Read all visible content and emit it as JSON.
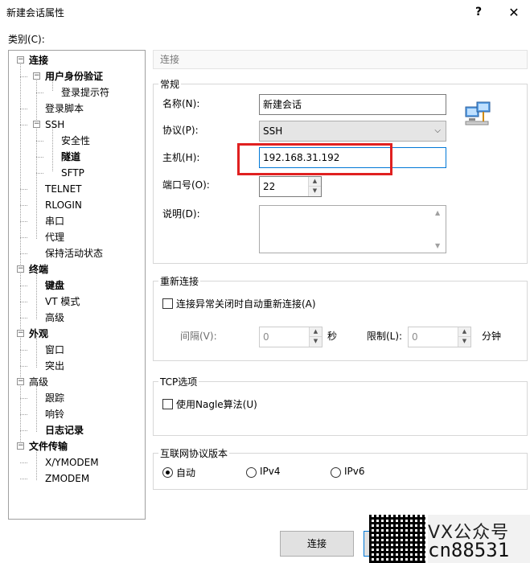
{
  "window": {
    "title": "新建会话属性",
    "help_glyph": "?",
    "close_glyph": "✕"
  },
  "category_label": "类别(C):",
  "tree": [
    {
      "label": "连接",
      "bold": true,
      "expander": "−"
    },
    {
      "label": "用户身份验证",
      "bold": true,
      "expander": "−"
    },
    {
      "label": "登录提示符",
      "bold": false
    },
    {
      "label": "登录脚本",
      "bold": false
    },
    {
      "label": "SSH",
      "bold": false,
      "expander": "−"
    },
    {
      "label": "安全性",
      "bold": false
    },
    {
      "label": "隧道",
      "bold": true
    },
    {
      "label": "SFTP",
      "bold": false
    },
    {
      "label": "TELNET",
      "bold": false
    },
    {
      "label": "RLOGIN",
      "bold": false
    },
    {
      "label": "串口",
      "bold": false
    },
    {
      "label": "代理",
      "bold": false
    },
    {
      "label": "保持活动状态",
      "bold": false
    },
    {
      "label": "终端",
      "bold": true,
      "expander": "−"
    },
    {
      "label": "键盘",
      "bold": true
    },
    {
      "label": "VT 模式",
      "bold": false
    },
    {
      "label": "高级",
      "bold": false
    },
    {
      "label": "外观",
      "bold": true,
      "expander": "−"
    },
    {
      "label": "窗口",
      "bold": false
    },
    {
      "label": "突出",
      "bold": false
    },
    {
      "label": "高级",
      "bold": false,
      "expander": "−"
    },
    {
      "label": "跟踪",
      "bold": false
    },
    {
      "label": "响铃",
      "bold": false
    },
    {
      "label": "日志记录",
      "bold": true
    },
    {
      "label": "文件传输",
      "bold": true,
      "expander": "−"
    },
    {
      "label": "X/YMODEM",
      "bold": false
    },
    {
      "label": "ZMODEM",
      "bold": false
    }
  ],
  "header": "连接",
  "general": {
    "title": "常规",
    "name_label": "名称(N):",
    "name_value": "新建会话",
    "protocol_label": "协议(P):",
    "protocol_value": "SSH",
    "host_label": "主机(H):",
    "host_value": "192.168.31.192",
    "port_label": "端口号(O):",
    "port_value": "22",
    "desc_label": "说明(D):"
  },
  "reconnect": {
    "title": "重新连接",
    "checkbox_label": "连接异常关闭时自动重新连接(A)",
    "interval_label": "间隔(V):",
    "interval_value": "0",
    "interval_unit": "秒",
    "limit_label": "限制(L):",
    "limit_value": "0",
    "limit_unit": "分钟"
  },
  "tcp": {
    "title": "TCP选项",
    "checkbox_label": "使用Nagle算法(U)"
  },
  "ipver": {
    "title": "互联网协议版本",
    "options": [
      "自动",
      "IPv4",
      "IPv6"
    ],
    "selected": "自动"
  },
  "buttons": {
    "connect": "连接"
  },
  "watermark": {
    "line1": "VX公众号",
    "line2": "cn88531"
  }
}
